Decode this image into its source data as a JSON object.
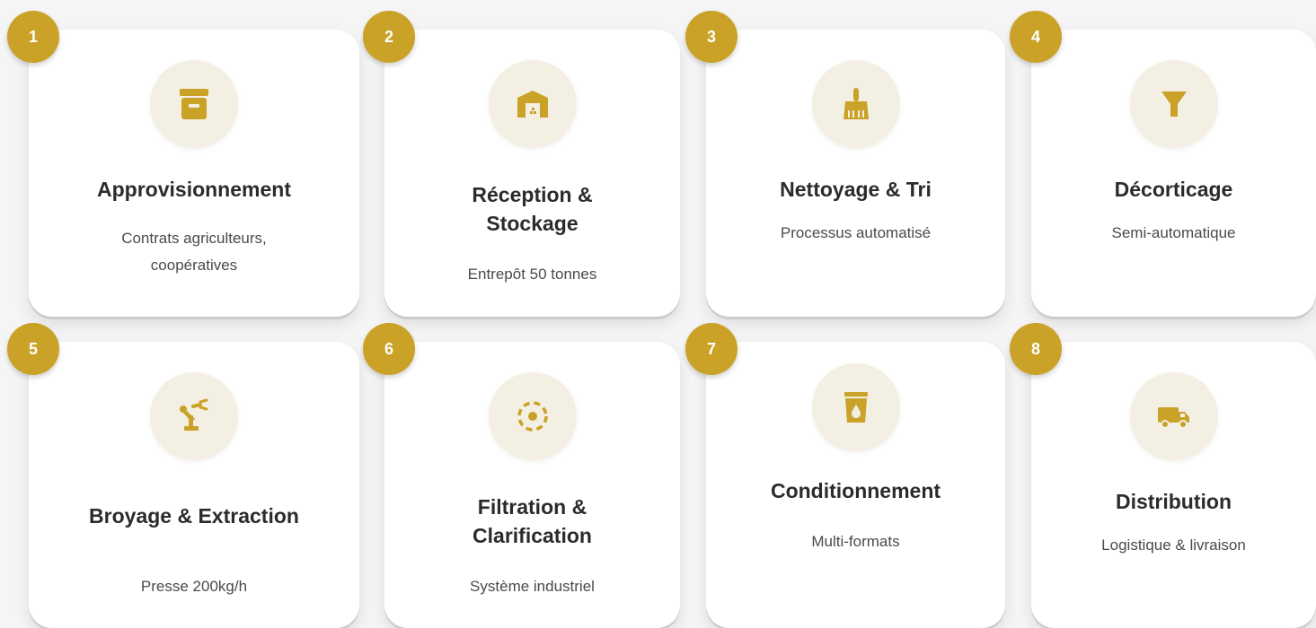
{
  "accent_color": "#c9a227",
  "icon_bg_color": "#f4efe3",
  "steps": [
    {
      "number": "1",
      "icon": "archive-box-icon",
      "title": "Approvisionnement",
      "description": "Contrats agriculteurs, coopératives"
    },
    {
      "number": "2",
      "icon": "warehouse-icon",
      "title": "Réception & Stockage",
      "description": "Entrepôt 50 tonnes"
    },
    {
      "number": "3",
      "icon": "broom-icon",
      "title": "Nettoyage & Tri",
      "description": "Processus automatisé"
    },
    {
      "number": "4",
      "icon": "filter-icon",
      "title": "Décorticage",
      "description": "Semi-automatique"
    },
    {
      "number": "5",
      "icon": "robot-arm-icon",
      "title": "Broyage & Extraction",
      "description": "Presse 200kg/h"
    },
    {
      "number": "6",
      "icon": "dashed-circle-target-icon",
      "title": "Filtration & Clarification",
      "description": "Système industriel"
    },
    {
      "number": "7",
      "icon": "oil-container-icon",
      "title": "Conditionnement",
      "description": "Multi-formats"
    },
    {
      "number": "8",
      "icon": "delivery-truck-icon",
      "title": "Distribution",
      "description": "Logistique & livraison"
    }
  ]
}
